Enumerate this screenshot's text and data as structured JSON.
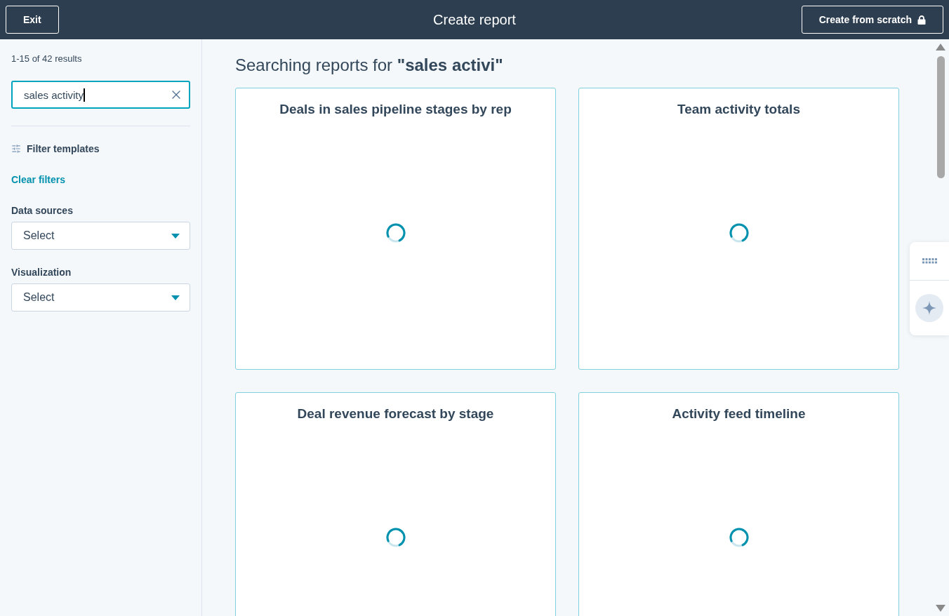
{
  "header": {
    "exit_button": "Exit",
    "title": "Create report",
    "create_button": {
      "label": "Create from scratch",
      "locked": true
    }
  },
  "sidebar": {
    "results_count": "1-15 of 42 results",
    "search": {
      "value": "sales activity",
      "focused": true
    },
    "filter_heading": "Filter templates",
    "clear_filters": "Clear filters",
    "filters": [
      {
        "label": "Data sources",
        "placeholder": "Select"
      },
      {
        "label": "Visualization",
        "placeholder": "Select"
      }
    ]
  },
  "main": {
    "heading": "Searching reports for **\"sales activi\"**",
    "cards": [
      {
        "title": "Deals in sales pipeline stages by rep",
        "loading": true
      },
      {
        "title": "Team activity totals",
        "loading": true
      },
      {
        "title": "Deal revenue forecast by stage",
        "loading": true
      },
      {
        "title": "Activity feed timeline",
        "loading": true
      }
    ]
  }
}
